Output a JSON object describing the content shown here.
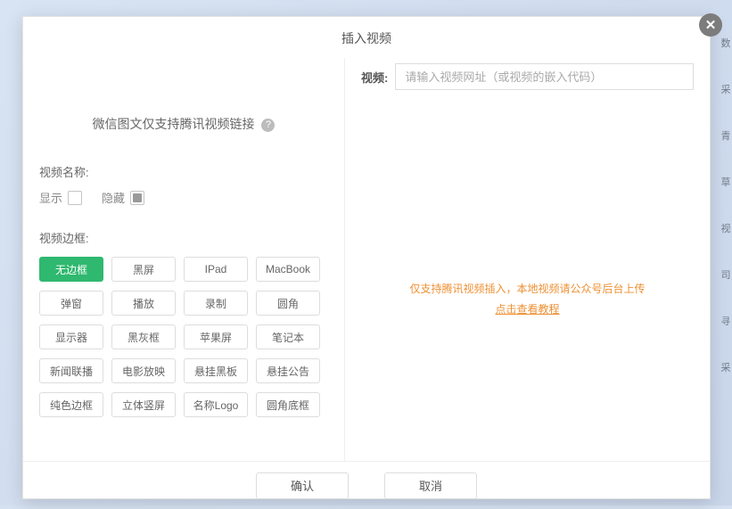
{
  "modal": {
    "title": "插入视频"
  },
  "left": {
    "wechat_tip": "微信图文仅支持腾讯视频链接",
    "name_label": "视频名称:",
    "show_label": "显示",
    "hide_label": "隐藏",
    "border_label": "视频边框:",
    "borders": [
      "无边框",
      "黑屏",
      "IPad",
      "MacBook",
      "弹窗",
      "播放",
      "录制",
      "圆角",
      "显示器",
      "黑灰框",
      "苹果屏",
      "笔记本",
      "新闻联播",
      "电影放映",
      "悬挂黑板",
      "悬挂公告",
      "纯色边框",
      "立体竖屏",
      "名称Logo",
      "圆角底框"
    ],
    "active_border_index": 0
  },
  "right": {
    "video_label": "视频:",
    "video_placeholder": "请输入视频网址（或视频的嵌入代码）",
    "support_line": "仅支持腾讯视频插入，本地视频请公众号后台上传",
    "support_link": "点击查看教程"
  },
  "footer": {
    "ok": "确认",
    "cancel": "取消"
  },
  "side_tabs": [
    "数",
    "采",
    "青",
    "草",
    "视",
    "司",
    "寻",
    "采"
  ]
}
